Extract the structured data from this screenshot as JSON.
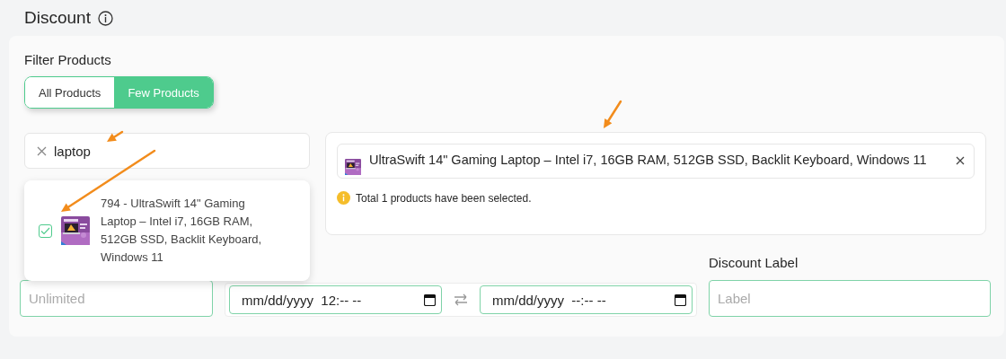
{
  "header": {
    "title": "Discount"
  },
  "filter": {
    "label": "Filter Products",
    "options": [
      {
        "label": "All Products",
        "selected": false
      },
      {
        "label": "Few Products",
        "selected": true
      }
    ]
  },
  "search": {
    "value": "laptop"
  },
  "dropdown": {
    "items": [
      {
        "text": "794 - UltraSwift 14\" Gaming Laptop – Intel i7, 16GB RAM, 512GB SSD, Backlit Keyboard, Windows 11",
        "checked": true
      }
    ]
  },
  "selected_products": [
    {
      "name": "UltraSwift 14\" Gaming Laptop – Intel i7, 16GB RAM, 512GB SSD, Backlit Keyboard, Windows 11"
    }
  ],
  "selection_note": "Total 1 products have been selected.",
  "usage": {
    "placeholder": "Unlimited"
  },
  "duration": {
    "start": "mm/dd/yyyy  12:-- --",
    "end": "mm/dd/yyyy  --:-- --"
  },
  "discount_label": {
    "label": "Discount Label",
    "placeholder": "Label"
  }
}
